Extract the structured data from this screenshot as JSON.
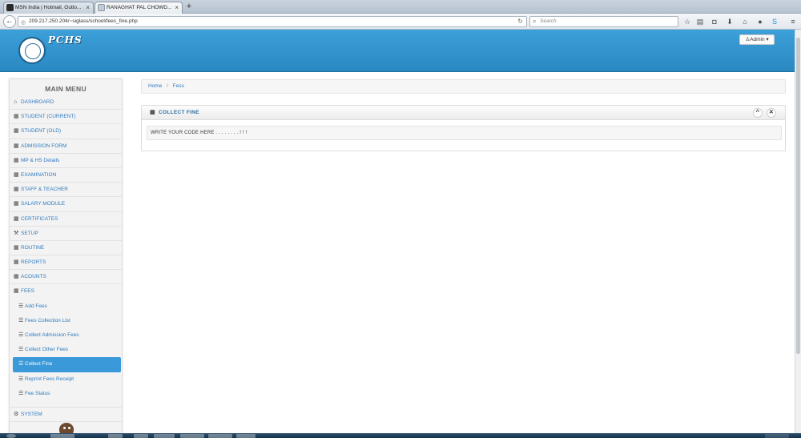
{
  "browser": {
    "tabs": [
      {
        "title": "MSN India | Hotmail, Outlo...",
        "favicon_color": "#2b2b2b",
        "active": false
      },
      {
        "title": "RANAGHAT PAL CHOWD...",
        "favicon_color": "#c0cbd6",
        "active": true
      }
    ],
    "new_tab": "+",
    "url": "209.217.250.204/~siglass/school/fees_fine.php",
    "search_placeholder": "Search"
  },
  "header": {
    "brand": "PCHS",
    "user_button": "Admin"
  },
  "sidebar": {
    "title": "MAIN MENU",
    "items": [
      {
        "label": "DASHBOARD",
        "icon": "home-icon",
        "glyph": "⌂"
      },
      {
        "label": "STUDENT (CURRENT)",
        "icon": "grid-icon",
        "glyph": "▦"
      },
      {
        "label": "STUDENT (OLD)",
        "icon": "grid-icon",
        "glyph": "▦"
      },
      {
        "label": "ADMISSION FORM",
        "icon": "grid-icon",
        "glyph": "▦"
      },
      {
        "label": "MP & HS Details",
        "icon": "grid-icon",
        "glyph": "▦"
      },
      {
        "label": "EXAMINATION",
        "icon": "grid-icon",
        "glyph": "▦"
      },
      {
        "label": "STAFF & TEACHER",
        "icon": "grid-icon",
        "glyph": "▦"
      },
      {
        "label": "SALARY MODULE",
        "icon": "grid-icon",
        "glyph": "▦"
      },
      {
        "label": "CERTIFICATES",
        "icon": "grid-icon",
        "glyph": "▦"
      },
      {
        "label": "SETUP",
        "icon": "wrench-icon",
        "glyph": "⚒"
      },
      {
        "label": "ROUTINE",
        "icon": "grid-icon",
        "glyph": "▦"
      },
      {
        "label": "REPORTS",
        "icon": "grid-icon",
        "glyph": "▦"
      },
      {
        "label": "ACOUNTS",
        "icon": "grid-icon",
        "glyph": "▦"
      },
      {
        "label": "FEES",
        "icon": "grid-icon",
        "glyph": "▦"
      }
    ],
    "fees_sub": [
      {
        "label": "Add Fees",
        "icon": "list-icon",
        "glyph": "☰"
      },
      {
        "label": "Fees Collection List",
        "icon": "list-icon",
        "glyph": "☰"
      },
      {
        "label": "Collect Admission Fees",
        "icon": "list-icon",
        "glyph": "☰"
      },
      {
        "label": "Collect Other Fees",
        "icon": "list-icon",
        "glyph": "☰"
      },
      {
        "label": "Collect Fine",
        "icon": "list-icon",
        "glyph": "☰"
      },
      {
        "label": "Reprint Fees Receipt",
        "icon": "list-icon",
        "glyph": "☰"
      },
      {
        "label": "Fee Status",
        "icon": "list-icon",
        "glyph": "☰"
      }
    ],
    "system": {
      "label": "SYSTEM",
      "icon": "gears-icon",
      "glyph": "⚙"
    }
  },
  "breadcrumb": {
    "home": "Home",
    "separator": "/",
    "current": "Fess"
  },
  "panel": {
    "title": "COLLECT FINE",
    "collapse_glyph": "^",
    "close_glyph": "✕",
    "body": "WRITE YOUR CODE HERE . . . . . . . . ! ! !"
  },
  "colors": {
    "header_blue": "#3399d6",
    "active_menu": "#3a99d8",
    "link": "#2e7bbf"
  }
}
